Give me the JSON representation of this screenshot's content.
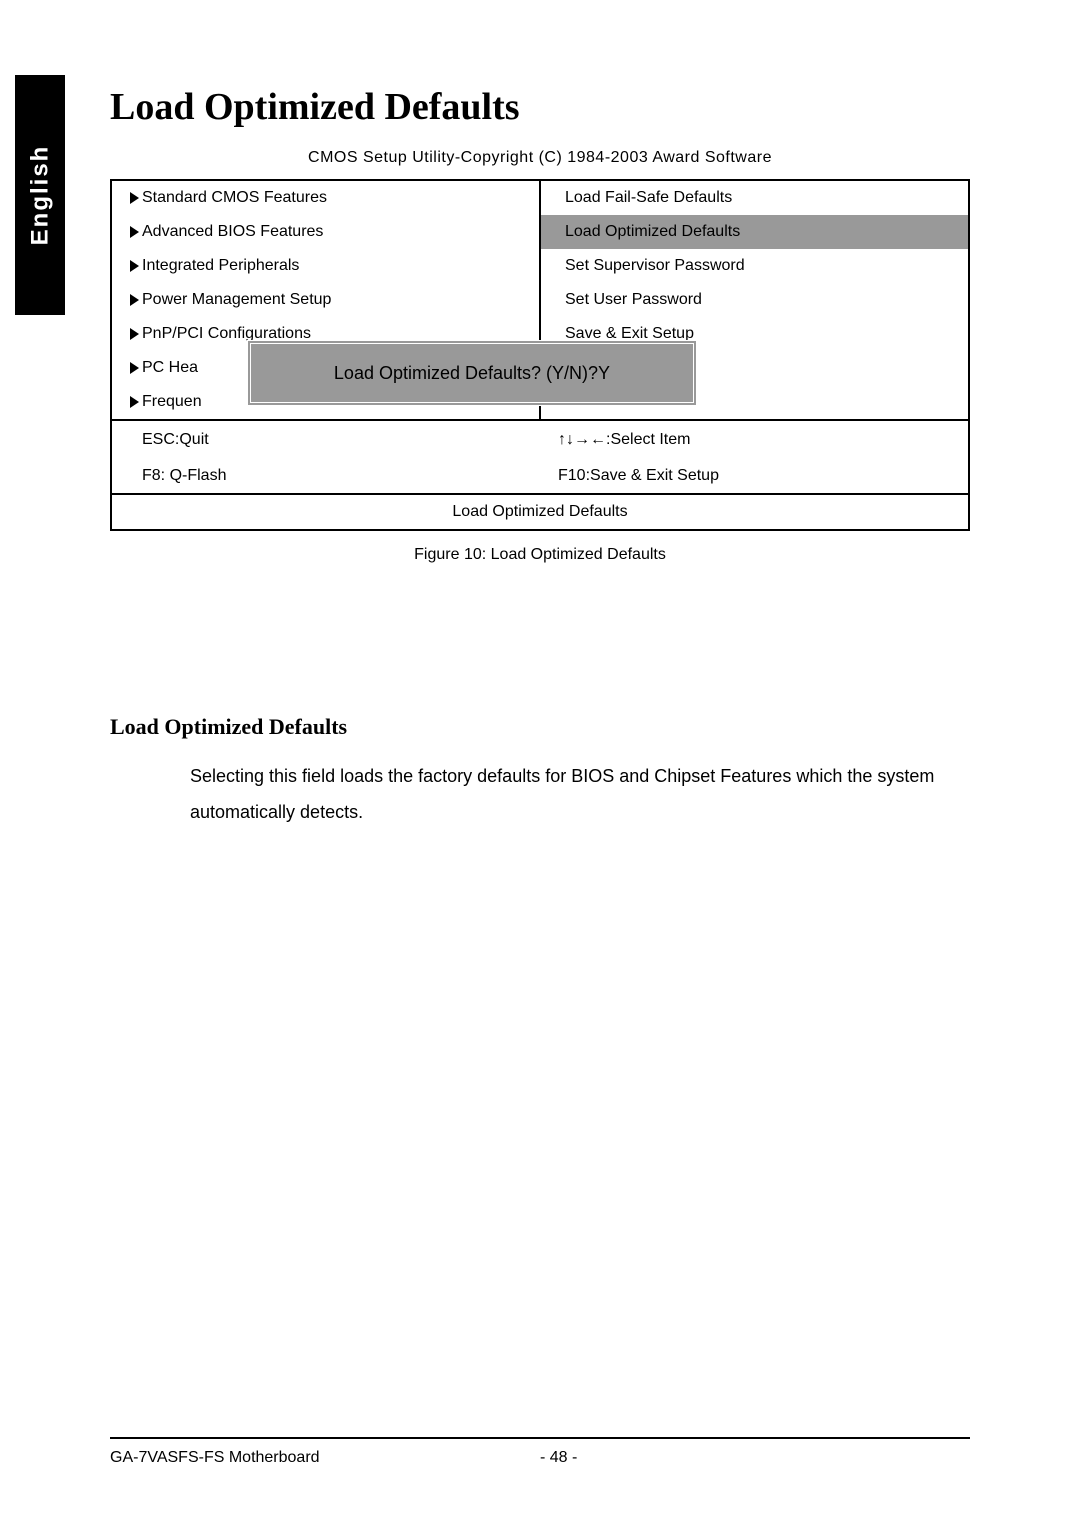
{
  "language_tab": "English",
  "page_title": "Load Optimized Defaults",
  "bios_caption": "CMOS Setup Utility-Copyright (C) 1984-2003 Award Software",
  "menu": {
    "left": [
      "Standard CMOS Features",
      "Advanced BIOS Features",
      "Integrated Peripherals",
      "Power Management Setup",
      "PnP/PCI Configurations",
      "PC Hea",
      "Frequen"
    ],
    "right": [
      "Load Fail-Safe Defaults",
      "Load Optimized Defaults",
      "Set Supervisor Password",
      "Set User Password",
      "Save & Exit Setup",
      "",
      ""
    ]
  },
  "dialog_text": "Load Optimized Defaults? (Y/N)?Y",
  "hints": {
    "esc": "ESC:Quit",
    "select": ":Select Item",
    "arrows": "↑↓→←",
    "f8": "F8: Q-Flash",
    "f10": "F10:Save & Exit Setup"
  },
  "status_bar": "Load Optimized Defaults",
  "figure_caption": "Figure 10: Load Optimized Defaults",
  "section_title": "Load Optimized Defaults",
  "body_text": "Selecting this field loads the factory defaults for BIOS and Chipset Features which the system automatically detects.",
  "footer": {
    "product": "GA-7VASFS-FS Motherboard",
    "page": "- 48 -"
  }
}
